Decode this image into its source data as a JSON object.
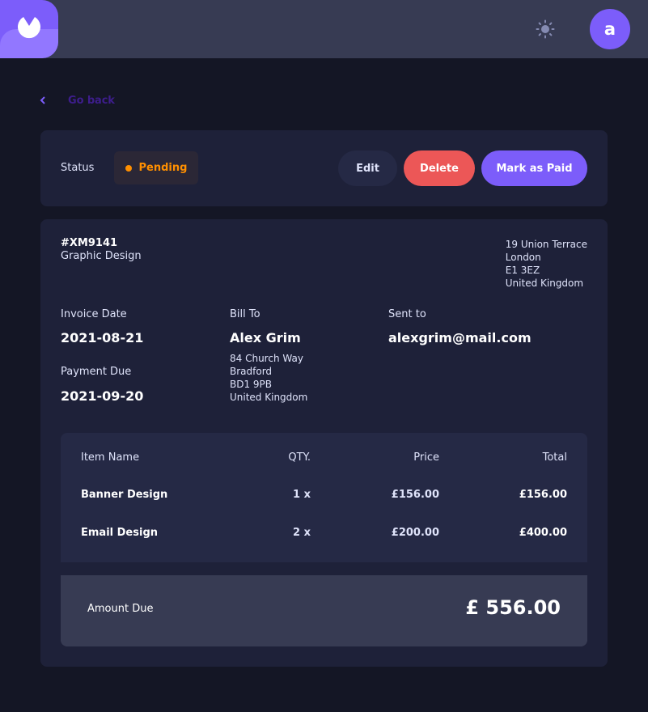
{
  "header": {
    "logo_icon": "logo-mark-icon",
    "theme_icon": "sun-icon",
    "avatar_initial": "a"
  },
  "nav": {
    "go_back_label": "Go back",
    "go_back_icon": "chevron-left-icon"
  },
  "status_bar": {
    "label": "Status",
    "status": "Pending",
    "status_color": "#FF8F00",
    "edit_label": "Edit",
    "delete_label": "Delete",
    "mark_paid_label": "Mark as Paid"
  },
  "invoice": {
    "id": "#XM9141",
    "description": "Graphic Design",
    "sender_address": [
      "19 Union Terrace",
      "London",
      "E1 3EZ",
      "United Kingdom"
    ],
    "invoice_date_label": "Invoice Date",
    "invoice_date": "2021-08-21",
    "payment_due_label": "Payment Due",
    "payment_due": "2021-09-20",
    "bill_to_label": "Bill To",
    "client_name": "Alex Grim",
    "client_address": [
      "84 Church Way",
      "Bradford",
      "BD1 9PB",
      "United Kingdom"
    ],
    "sent_to_label": "Sent to",
    "client_email": "alexgrim@mail.com"
  },
  "items": {
    "headers": {
      "name": "Item Name",
      "qty": "QTY.",
      "price": "Price",
      "total": "Total"
    },
    "rows": [
      {
        "name": "Banner Design",
        "qty": "1 x",
        "price": "£156.00",
        "total": "£156.00"
      },
      {
        "name": "Email Design",
        "qty": "2 x",
        "price": "£200.00",
        "total": "£400.00"
      }
    ]
  },
  "amount_due": {
    "label": "Amount Due",
    "value": "£ 556.00"
  },
  "colors": {
    "accent": "#7C5DFA",
    "danger": "#EC5757",
    "background": "#141625",
    "card": "#1E2139"
  }
}
